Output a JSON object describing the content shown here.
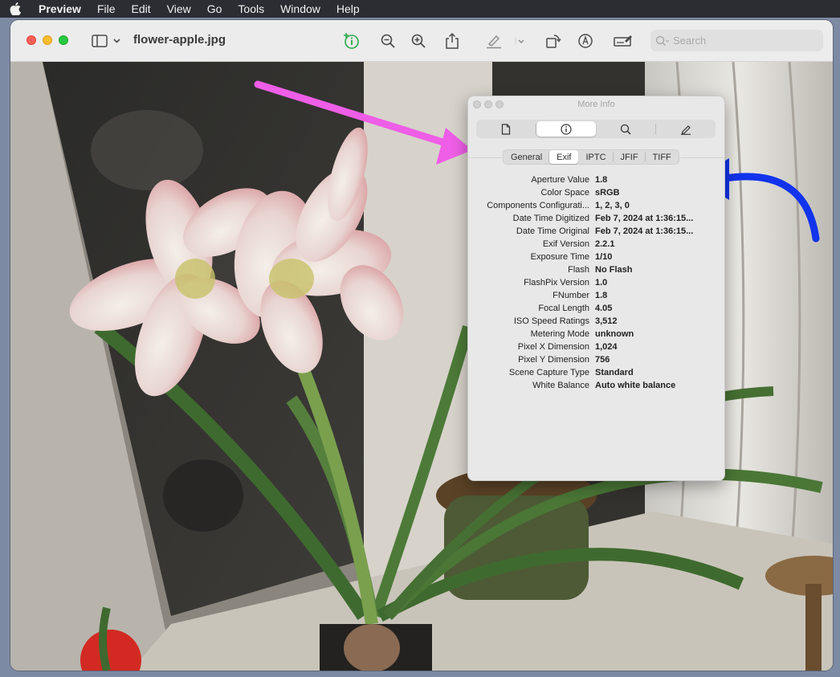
{
  "menubar": {
    "app_name": "Preview",
    "items": [
      "File",
      "Edit",
      "View",
      "Go",
      "Tools",
      "Window",
      "Help"
    ]
  },
  "window": {
    "title": "flower-apple.jpg",
    "search_placeholder": "Search"
  },
  "panel": {
    "title": "More Info",
    "tabs": [
      {
        "icon": "document-icon"
      },
      {
        "icon": "info-icon",
        "active": true
      },
      {
        "icon": "magnifier-icon"
      },
      {
        "icon": "pencil-icon"
      }
    ],
    "subtabs": [
      {
        "label": "General"
      },
      {
        "label": "Exif",
        "active": true
      },
      {
        "label": "IPTC"
      },
      {
        "label": "JFIF"
      },
      {
        "label": "TIFF"
      }
    ],
    "rows": [
      {
        "label": "Aperture Value",
        "value": "1.8"
      },
      {
        "label": "Color Space",
        "value": "sRGB"
      },
      {
        "label": "Components Configurati...",
        "value": "1, 2, 3, 0"
      },
      {
        "label": "Date Time Digitized",
        "value": "Feb 7, 2024 at 1:36:15..."
      },
      {
        "label": "Date Time Original",
        "value": "Feb 7, 2024 at 1:36:15..."
      },
      {
        "label": "Exif Version",
        "value": "2.2.1"
      },
      {
        "label": "Exposure Time",
        "value": "1/10"
      },
      {
        "label": "Flash",
        "value": "No Flash"
      },
      {
        "label": "FlashPix Version",
        "value": "1.0"
      },
      {
        "label": "FNumber",
        "value": "1.8"
      },
      {
        "label": "Focal Length",
        "value": "4.05"
      },
      {
        "label": "ISO Speed Ratings",
        "value": "3,512"
      },
      {
        "label": "Metering Mode",
        "value": "unknown"
      },
      {
        "label": "Pixel X Dimension",
        "value": "1,024"
      },
      {
        "label": "Pixel Y Dimension",
        "value": "756"
      },
      {
        "label": "Scene Capture Type",
        "value": "Standard"
      },
      {
        "label": "White Balance",
        "value": "Auto white balance"
      }
    ]
  },
  "colors": {
    "annotation_pink": "#ee5ee6",
    "annotation_blue": "#1233ec"
  }
}
